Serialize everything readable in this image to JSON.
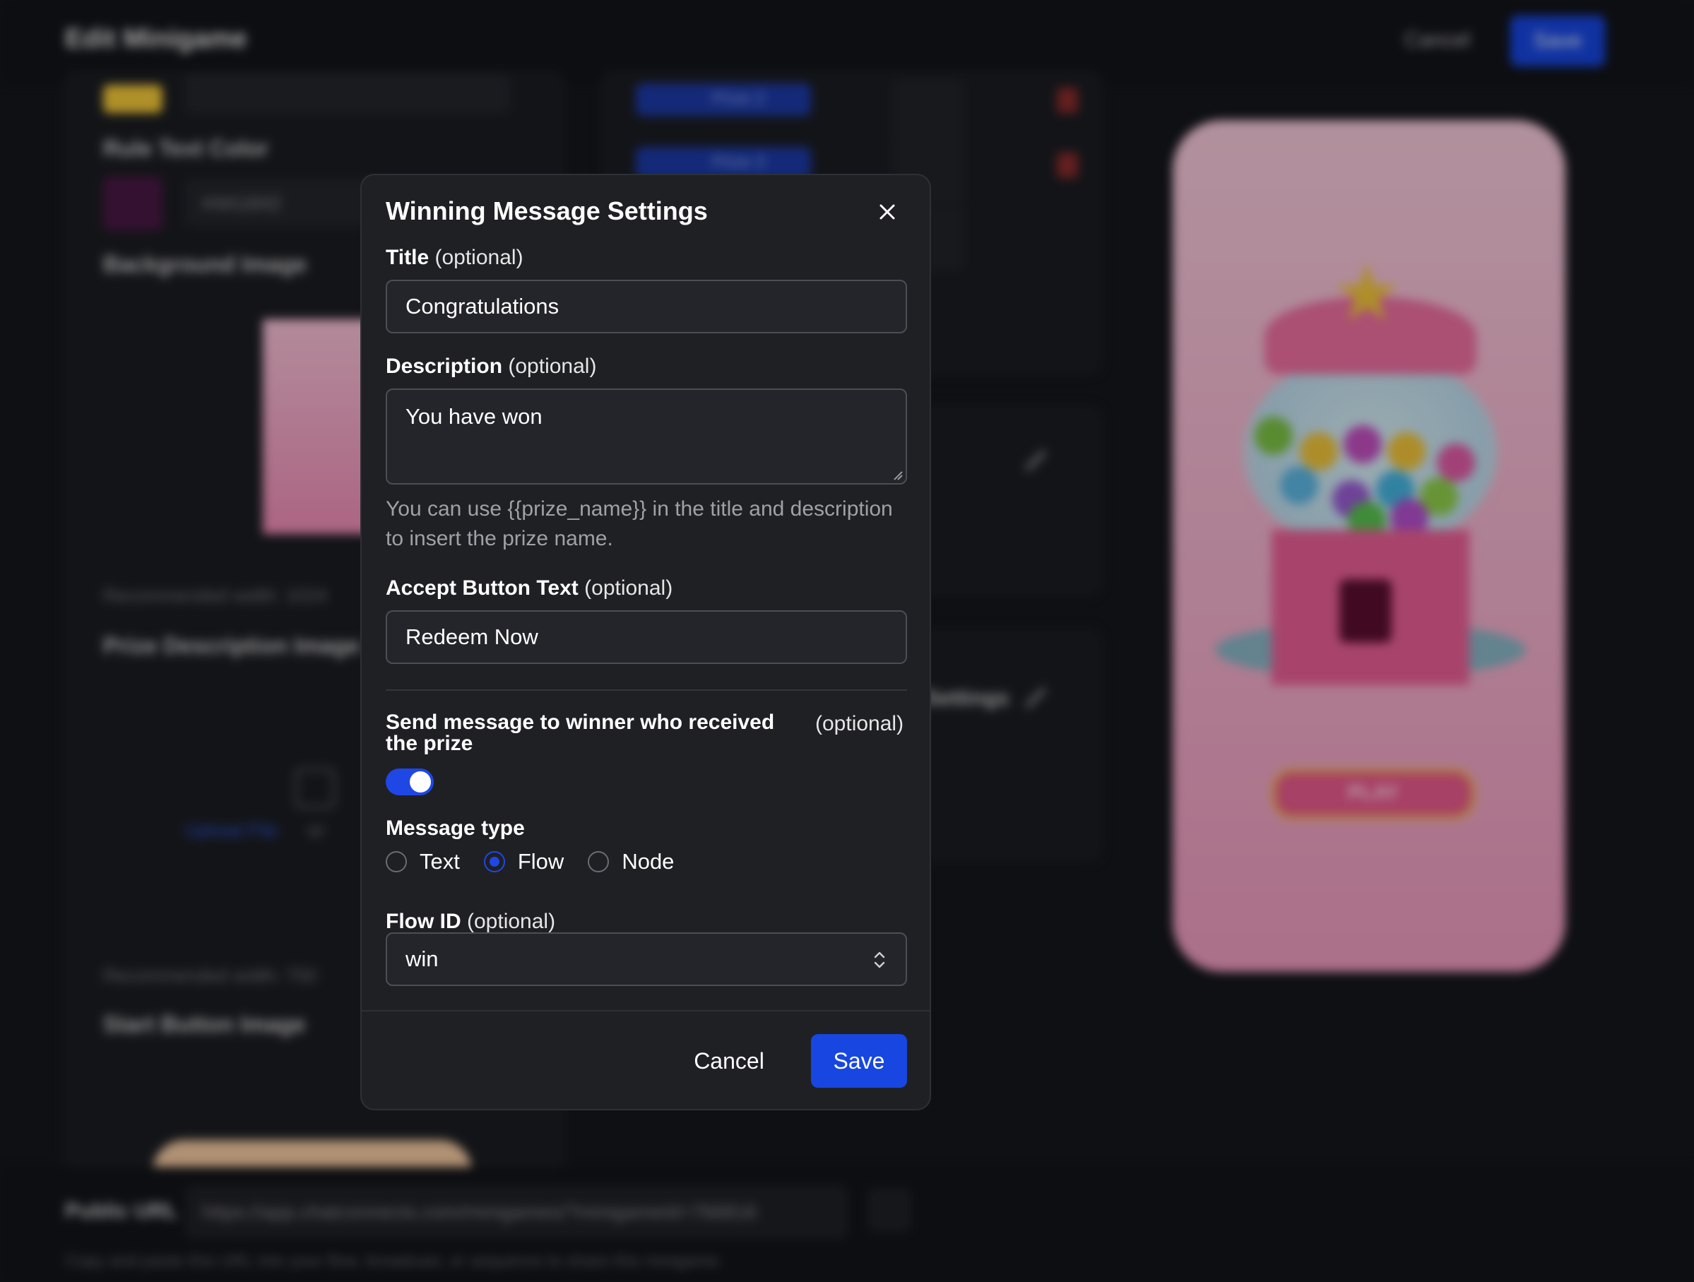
{
  "background": {
    "page_title": "Edit Minigame",
    "cancel_label": "Cancel",
    "save_label": "Save",
    "public_url_label": "Public URL",
    "public_url_value": "https://app.chatconnects.com/minigames/?minigameId=766816",
    "url_hint": "Copy and paste this URL into your flow, broadcast, or sequence to share this minigame.",
    "rule_text_color_label": "Rule Text Color",
    "rule_text_color_value": "#4A1842",
    "background_image_label": "Background Image",
    "recommended_width_1": "Recommended width: 1024",
    "prize_description_label": "Prize Description Image (Optional)",
    "upload_file_label": "Upload File",
    "or_label": "or",
    "recommended_width_2": "Recommended width: 750",
    "start_button_image_label": "Start Button Image",
    "prize_labels": [
      "Prize 2",
      "Prize 3"
    ],
    "settings_label": "Settings",
    "phone_play_label": "PLAY",
    "colors": {
      "accent": "#1746e0",
      "page_bg": "#15171c",
      "modal_bg": "#1f2024"
    }
  },
  "modal": {
    "title": "Winning Message Settings",
    "close_icon": "close-icon",
    "title_field": {
      "label": "Title",
      "optional": "(optional)",
      "value": "Congratulations"
    },
    "description_field": {
      "label": "Description",
      "optional": "(optional)",
      "value": "You have won"
    },
    "hint": "You can use {{prize_name}} in the title and description to insert the prize name.",
    "accept_field": {
      "label": "Accept Button Text",
      "optional": "(optional)",
      "value": "Redeem Now"
    },
    "send_message": {
      "label": "Send message to winner who received the prize",
      "optional": "(optional)",
      "enabled": true
    },
    "message_type": {
      "label": "Message type",
      "options": [
        "Text",
        "Flow",
        "Node"
      ],
      "selected": "Flow"
    },
    "flow_id": {
      "label": "Flow ID",
      "optional": "(optional)",
      "value": "win"
    },
    "cancel_label": "Cancel",
    "save_label": "Save"
  }
}
